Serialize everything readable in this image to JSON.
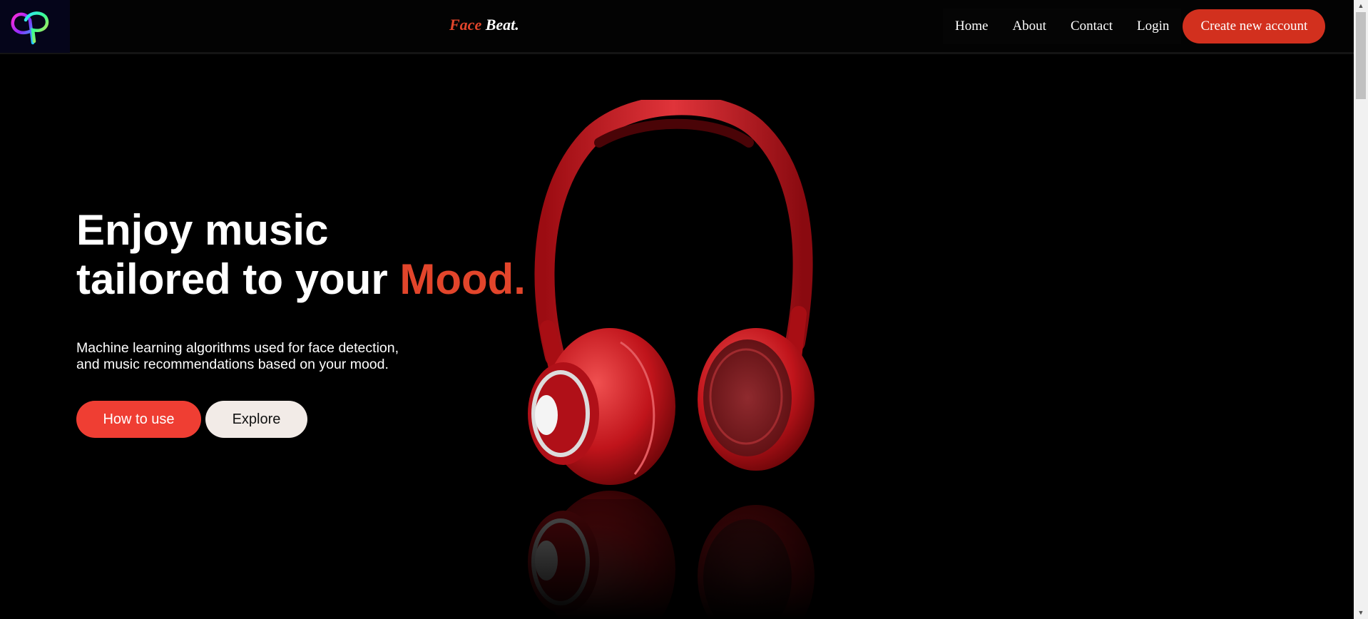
{
  "nav": {
    "brand_part1": "Face",
    "brand_part2": "Beat.",
    "links": [
      {
        "label": "Home"
      },
      {
        "label": "About"
      },
      {
        "label": "Contact"
      },
      {
        "label": "Login"
      }
    ],
    "cta_label": "Create new account"
  },
  "hero": {
    "headline_line1": "Enjoy music",
    "headline_line2_prefix": "tailored to your ",
    "headline_accent": "Mood.",
    "subtitle_line1": "Machine learning algorithms used for face detection,",
    "subtitle_line2": "and music recommendations based on your mood.",
    "primary_button": "How to use",
    "secondary_button": "Explore"
  },
  "icons": {
    "logo": "overlapping-gradient-loops-logo",
    "hero_image": "red-headphones-image",
    "scroll_up": "triangle-up",
    "scroll_down": "triangle-down"
  },
  "colors": {
    "accent": "#e2452b",
    "cta": "#d2301e",
    "primary_button": "#ef3e33",
    "secondary_button": "#f2ebe7",
    "background": "#000000"
  }
}
